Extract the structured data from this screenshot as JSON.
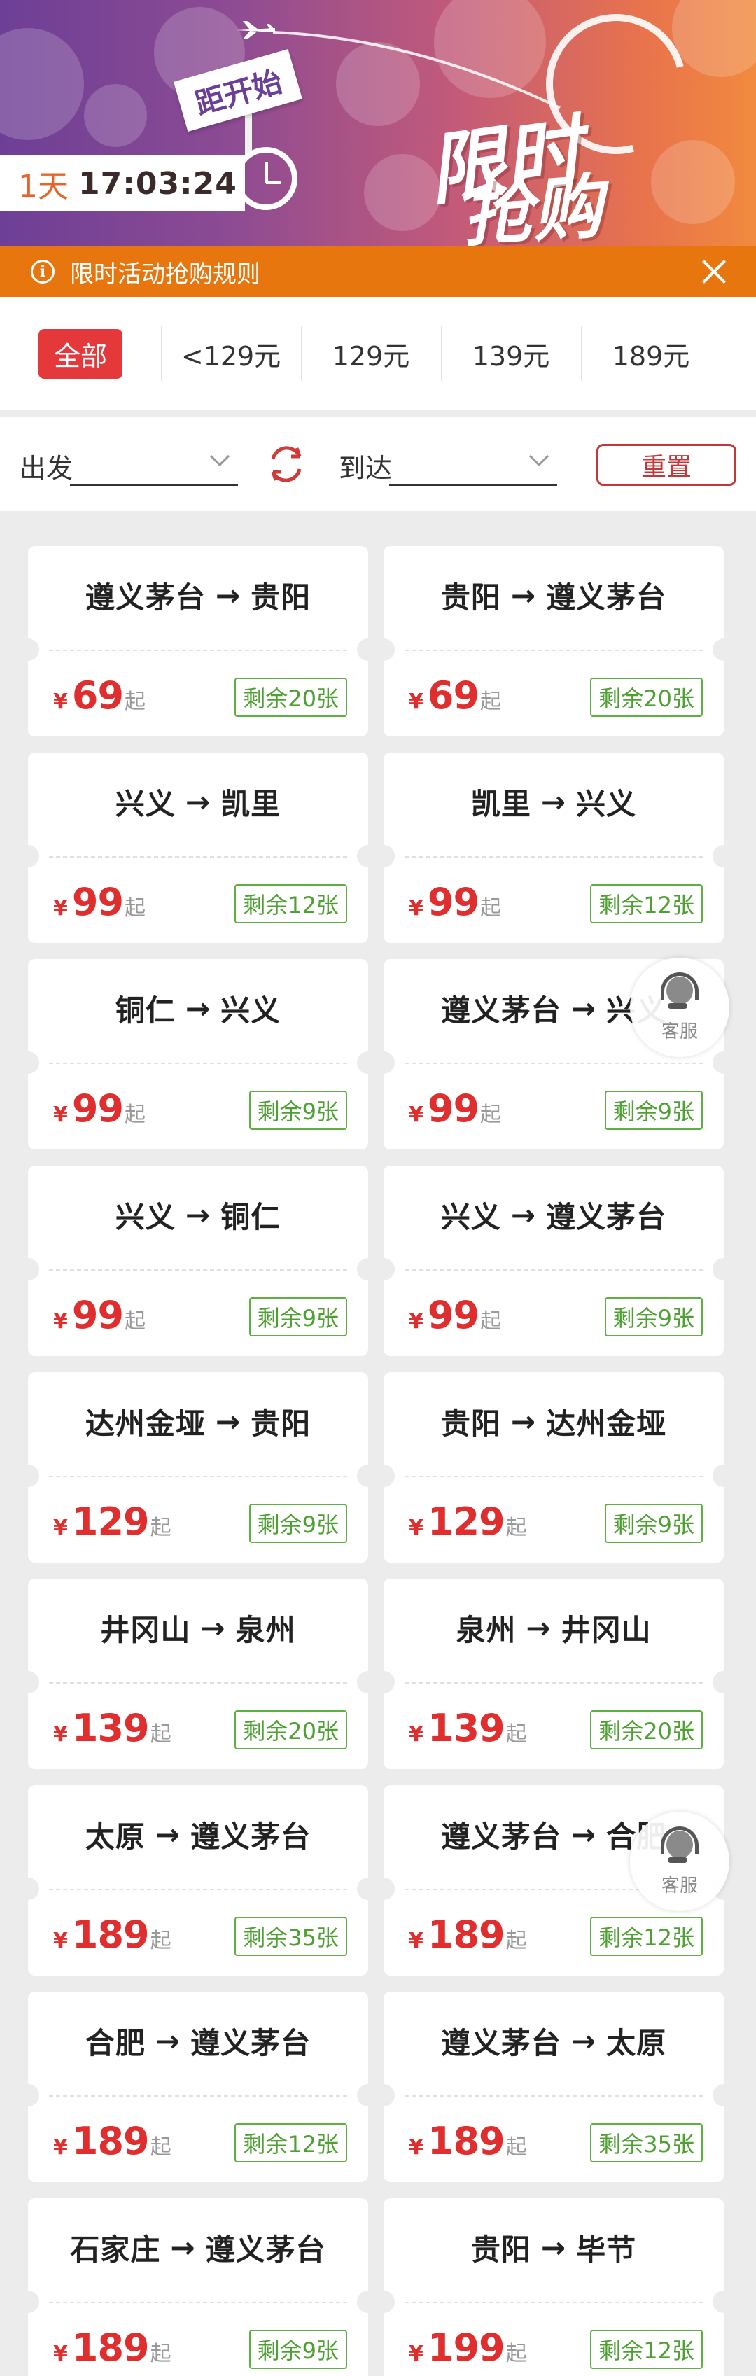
{
  "banner": {
    "start_label": "距开始",
    "countdown_days": "1天",
    "countdown_time": "17:03:24",
    "title_line1": "限时",
    "title_line2": "抢购"
  },
  "rules_bar": {
    "text": "限时活动抢购规则",
    "info_icon": "info-icon",
    "close_icon": "close-icon"
  },
  "price_filter": {
    "items": [
      "全部",
      "<129元",
      "129元",
      "139元",
      "189元"
    ],
    "selected": 0
  },
  "route_selector": {
    "from_label": "出发",
    "to_label": "到达",
    "reset_label": "重置",
    "swap_icon": "swap-icon"
  },
  "cards": [
    {
      "from": "遵义茅台",
      "to": "贵阳",
      "price": "69",
      "stock": "剩余20张"
    },
    {
      "from": "贵阳",
      "to": "遵义茅台",
      "price": "69",
      "stock": "剩余20张"
    },
    {
      "from": "兴义",
      "to": "凯里",
      "price": "99",
      "stock": "剩余12张"
    },
    {
      "from": "凯里",
      "to": "兴义",
      "price": "99",
      "stock": "剩余12张"
    },
    {
      "from": "铜仁",
      "to": "兴义",
      "price": "99",
      "stock": "剩余9张"
    },
    {
      "from": "遵义茅台",
      "to": "兴义",
      "price": "99",
      "stock": "剩余9张"
    },
    {
      "from": "兴义",
      "to": "铜仁",
      "price": "99",
      "stock": "剩余9张"
    },
    {
      "from": "兴义",
      "to": "遵义茅台",
      "price": "99",
      "stock": "剩余9张"
    },
    {
      "from": "达州金垭",
      "to": "贵阳",
      "price": "129",
      "stock": "剩余9张"
    },
    {
      "from": "贵阳",
      "to": "达州金垭",
      "price": "129",
      "stock": "剩余9张"
    },
    {
      "from": "井冈山",
      "to": "泉州",
      "price": "139",
      "stock": "剩余20张"
    },
    {
      "from": "泉州",
      "to": "井冈山",
      "price": "139",
      "stock": "剩余20张"
    },
    {
      "from": "太原",
      "to": "遵义茅台",
      "price": "189",
      "stock": "剩余35张"
    },
    {
      "from": "遵义茅台",
      "to": "合肥",
      "price": "189",
      "stock": "剩余12张"
    },
    {
      "from": "合肥",
      "to": "遵义茅台",
      "price": "189",
      "stock": "剩余12张"
    },
    {
      "from": "遵义茅台",
      "to": "太原",
      "price": "189",
      "stock": "剩余35张"
    },
    {
      "from": "石家庄",
      "to": "遵义茅台",
      "price": "189",
      "stock": "剩余9张"
    },
    {
      "from": "贵阳",
      "to": "毕节",
      "price": "199",
      "stock": "剩余12张"
    }
  ],
  "card_common": {
    "currency": "¥",
    "from_suffix": "起",
    "arrow": "→"
  },
  "customer_service": {
    "label": "客服",
    "icon": "headset-icon"
  },
  "colors": {
    "accent_red": "#e02d2d",
    "rules_orange": "#e8760f",
    "stock_green": "#4ea033"
  }
}
